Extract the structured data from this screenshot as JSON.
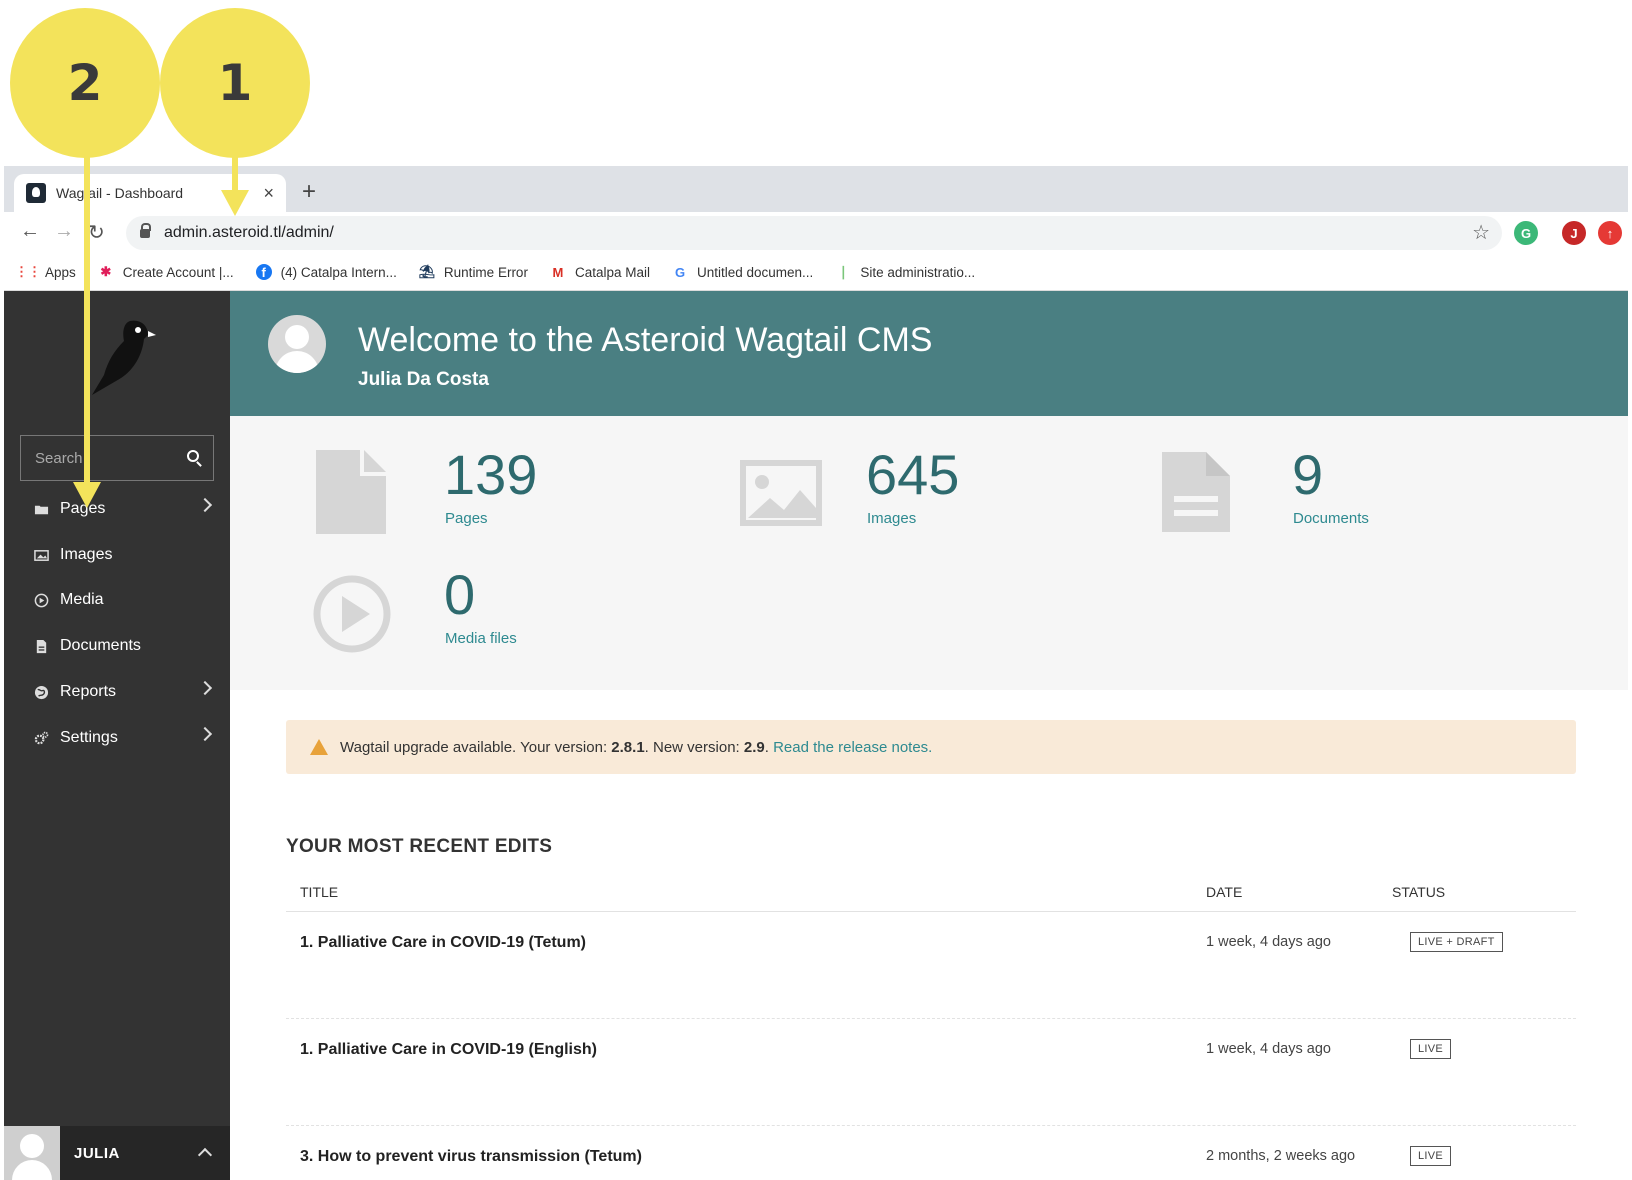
{
  "callouts": [
    {
      "number": "1"
    },
    {
      "number": "2"
    }
  ],
  "browser": {
    "tab_title": "Wagtail - Dashboard",
    "tab_close": "×",
    "new_tab": "+",
    "url": "admin.asteroid.tl/admin/",
    "ext_user_initial": "J",
    "bookmarks": [
      {
        "label": "Apps",
        "icon": "apps-grid-icon"
      },
      {
        "label": "Create Account |...",
        "icon": "slack-icon"
      },
      {
        "label": "(4) Catalpa Intern...",
        "icon": "facebook-icon"
      },
      {
        "label": "Runtime Error",
        "icon": "island-icon"
      },
      {
        "label": "Catalpa Mail",
        "icon": "gmail-icon"
      },
      {
        "label": "Untitled documen...",
        "icon": "google-icon"
      },
      {
        "label": "Site administratio...",
        "icon": "django-icon"
      }
    ]
  },
  "sidebar": {
    "search_placeholder": "Search",
    "items": [
      {
        "label": "Pages",
        "icon": "folder-icon",
        "has_submenu": true
      },
      {
        "label": "Images",
        "icon": "image-icon",
        "has_submenu": false
      },
      {
        "label": "Media",
        "icon": "play-icon",
        "has_submenu": false
      },
      {
        "label": "Documents",
        "icon": "document-icon",
        "has_submenu": false
      },
      {
        "label": "Reports",
        "icon": "globe-icon",
        "has_submenu": true
      },
      {
        "label": "Settings",
        "icon": "cogs-icon",
        "has_submenu": true
      }
    ],
    "user": "JULIA"
  },
  "header": {
    "welcome": "Welcome to the Asteroid Wagtail CMS",
    "user_name": "Julia Da Costa",
    "color": "#4a7f82"
  },
  "stats": [
    {
      "value": "139",
      "label": "Pages",
      "icon": "page-icon"
    },
    {
      "value": "645",
      "label": "Images",
      "icon": "image-icon"
    },
    {
      "value": "9",
      "label": "Documents",
      "icon": "document-icon"
    },
    {
      "value": "0",
      "label": "Media files",
      "icon": "play-icon"
    }
  ],
  "alert": {
    "prefix": "Wagtail upgrade available. Your version: ",
    "current_version": "2.8.1",
    "middle": ". New version: ",
    "new_version": "2.9",
    "suffix": ". ",
    "link": "Read the release notes."
  },
  "recent_edits": {
    "title": "YOUR MOST RECENT EDITS",
    "columns": [
      "TITLE",
      "DATE",
      "STATUS"
    ],
    "rows": [
      {
        "title": "1. Palliative Care in COVID-19 (Tetum)",
        "date": "1 week, 4 days ago",
        "status": "LIVE + DRAFT"
      },
      {
        "title": "1. Palliative Care in COVID-19 (English)",
        "date": "1 week, 4 days ago",
        "status": "LIVE"
      },
      {
        "title": "3. How to prevent virus transmission (Tetum)",
        "date": "2 months, 2 weeks ago",
        "status": "LIVE"
      }
    ]
  }
}
